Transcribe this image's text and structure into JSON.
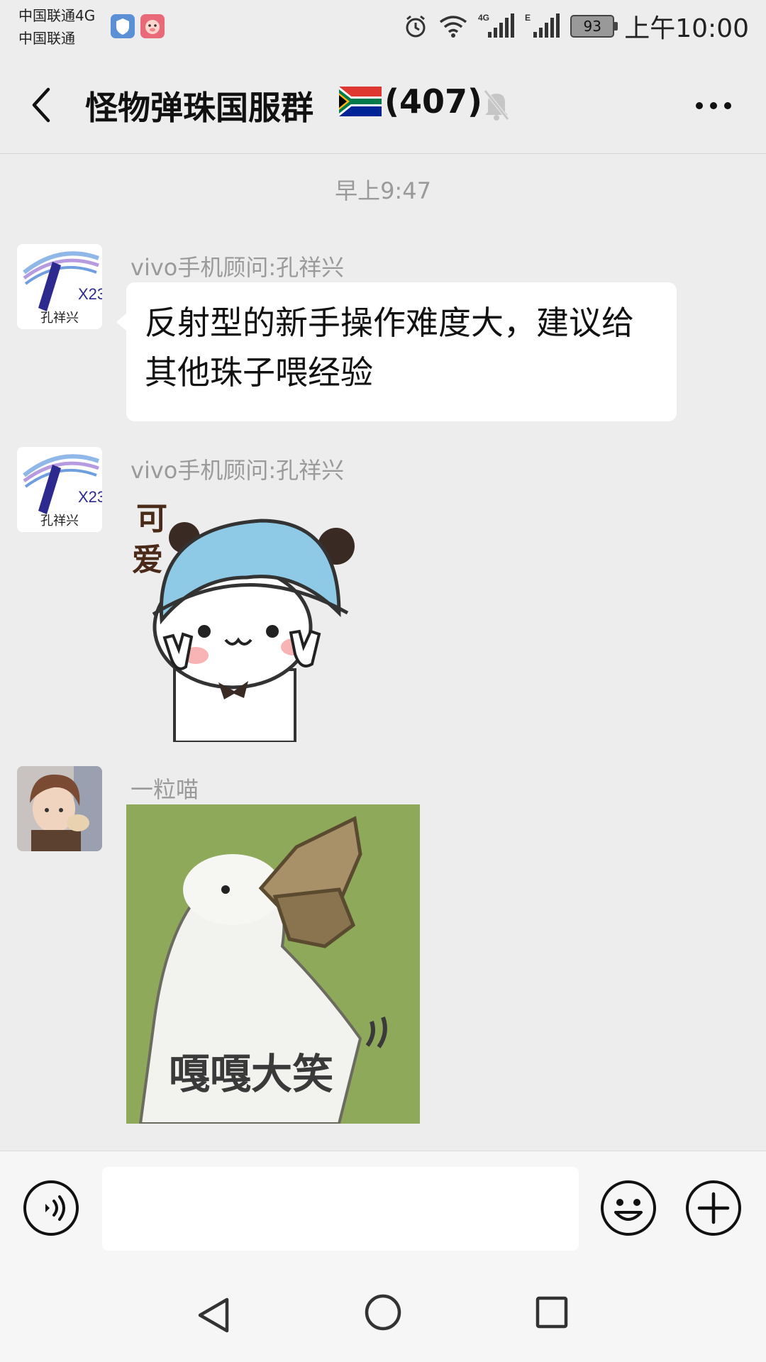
{
  "status_bar": {
    "carrier_1": "中国联通4G",
    "carrier_2": "中国联通",
    "battery": "93",
    "time": "上午10:00",
    "icons": [
      "shield-app-icon",
      "pig-app-icon",
      "alarm-icon",
      "wifi-icon",
      "signal-4g-icon",
      "signal-e-icon",
      "battery-icon"
    ]
  },
  "header": {
    "title": "怪物弹珠国服群",
    "member_count": "(407)",
    "icons": [
      "back-icon",
      "south-africa-flag-icon",
      "mute-bell-icon",
      "more-icon"
    ]
  },
  "chat": {
    "time_separator": "早上9:47",
    "messages": [
      {
        "sender": "vivo手机顾问:孔祥兴",
        "avatar_text": "孔祥兴",
        "avatar_badge": "X23",
        "type": "text",
        "text": "反射型的新手操作难度大，建议给其他珠子喂经验"
      },
      {
        "sender": "vivo手机顾问:孔祥兴",
        "avatar_text": "孔祥兴",
        "avatar_badge": "X23",
        "type": "sticker",
        "sticker_caption": "可爱"
      },
      {
        "sender": "一粒喵",
        "type": "sticker",
        "sticker_caption": "嘎嘎大笑"
      }
    ]
  },
  "input_bar": {
    "placeholder": "",
    "icons": [
      "voice-icon",
      "emoji-icon",
      "plus-icon"
    ]
  },
  "nav_bar": {
    "icons": [
      "nav-back-icon",
      "nav-home-icon",
      "nav-recent-icon"
    ]
  },
  "colors": {
    "background": "#ededed",
    "bubble": "#ffffff",
    "muted_text": "#9a9a9a",
    "sticker_green": "#8fa95a",
    "hat_blue": "#8ecae6"
  }
}
